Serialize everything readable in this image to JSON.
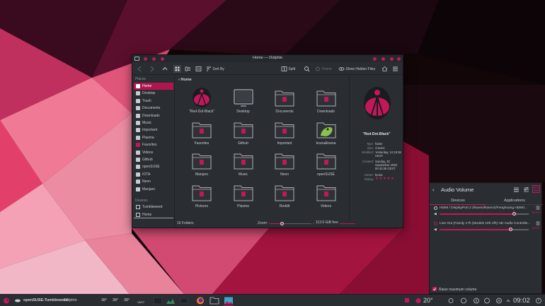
{
  "colors": {
    "accent": "#c2185b",
    "window_bg": "#2a2e33",
    "panel_bg": "#2a2e33"
  },
  "window": {
    "title": "Home — Dolphin",
    "toolbar": {
      "sort_label": "Sort By",
      "split_label": "Split",
      "delete_label": "Delete",
      "hidden_label": "Show Hidden Files"
    },
    "sidebar": {
      "places_heading": "Places",
      "places": [
        {
          "label": "Home",
          "icon": "home-icon"
        },
        {
          "label": "Desktop",
          "icon": "desktop-icon"
        },
        {
          "label": "Trash",
          "icon": "trash-icon"
        },
        {
          "label": "Documents",
          "icon": "documents-icon"
        },
        {
          "label": "Downloads",
          "icon": "downloads-icon"
        },
        {
          "label": "Music",
          "icon": "music-icon"
        },
        {
          "label": "Important",
          "icon": "important-icon"
        },
        {
          "label": "Plasma",
          "icon": "plasma-icon"
        },
        {
          "label": "Favorites",
          "icon": "star-icon"
        },
        {
          "label": "Videos",
          "icon": "videos-icon"
        },
        {
          "label": "Github",
          "icon": "github-icon"
        },
        {
          "label": "openSUSE",
          "icon": "opensuse-icon"
        },
        {
          "label": "IOTA",
          "icon": "folder-icon"
        },
        {
          "label": "Neon",
          "icon": "neon-icon"
        },
        {
          "label": "Manjaro",
          "icon": "manjaro-icon"
        }
      ],
      "devices_heading": "Devices",
      "devices": [
        {
          "label": "Tumbleweed",
          "icon": "drive-icon"
        },
        {
          "label": "Home",
          "icon": "drive-icon"
        }
      ]
    },
    "breadcrumb": "Home",
    "files": [
      {
        "name": "\"Red-Dot-Black\"",
        "icon": "red-dot-black-icon"
      },
      {
        "name": "Desktop",
        "icon": "desktop-icon"
      },
      {
        "name": "Documents",
        "icon": "documents-icon"
      },
      {
        "name": "Downloads",
        "icon": "downloads-icon"
      },
      {
        "name": "Favorites",
        "icon": "star-icon"
      },
      {
        "name": "Github",
        "icon": "github-icon"
      },
      {
        "name": "Important",
        "icon": "important-icon"
      },
      {
        "name": "kruna&ivana",
        "icon": "image-icon"
      },
      {
        "name": "Manjaro",
        "icon": "manjaro-icon"
      },
      {
        "name": "Music",
        "icon": "music-icon"
      },
      {
        "name": "Neon",
        "icon": "neon-icon"
      },
      {
        "name": "openSUSE",
        "icon": "opensuse-icon"
      },
      {
        "name": "Pictures",
        "icon": "pictures-icon"
      },
      {
        "name": "Plasma",
        "icon": "plasma-icon"
      },
      {
        "name": "Reddit",
        "icon": "reddit-icon"
      },
      {
        "name": "Videos",
        "icon": "videos-icon"
      }
    ],
    "info": {
      "name": "\"Red-Dot-Black\"",
      "rows": [
        {
          "label": "Type:",
          "value": "folder"
        },
        {
          "label": "Size:",
          "value": "3 items"
        },
        {
          "label": "Modified:",
          "value": "Yesterday, 12:19:36 CEST"
        },
        {
          "label": "Created:",
          "value": "Sunday, 20 September 2020 00:43:28 CEST"
        },
        {
          "label": "Owner:",
          "value": "kruna"
        },
        {
          "label": "Rating:",
          "value": ""
        }
      ],
      "rating_stars": 5
    },
    "status": {
      "count": "16 Folders",
      "zoom_label": "Zoom:",
      "zoom_level": 0.3,
      "free": "113.0 GiB free"
    }
  },
  "audio": {
    "title": "Audio Volume",
    "tabs": [
      "Devices",
      "Applications"
    ],
    "devices": [
      {
        "name": "HDMI / DisplayPort 2 (Raven/Raven2/Fenghuang HDMI/...",
        "percent": "125%",
        "level": 1.25
      },
      {
        "name": "Line Out (Family 17h (Models 10h-1fh) HD Audio Controlle...",
        "percent": "120%",
        "level": 1.2
      }
    ],
    "raise_label": "Raise maximum volume"
  },
  "taskbar": {
    "active_window": "openSUSE-Tumbleweed",
    "app_label": "Dolphin",
    "temps": [
      "38°",
      "38°",
      "38°"
    ],
    "vast_label": "VAST",
    "weather": "20°",
    "clock": "09:02"
  }
}
